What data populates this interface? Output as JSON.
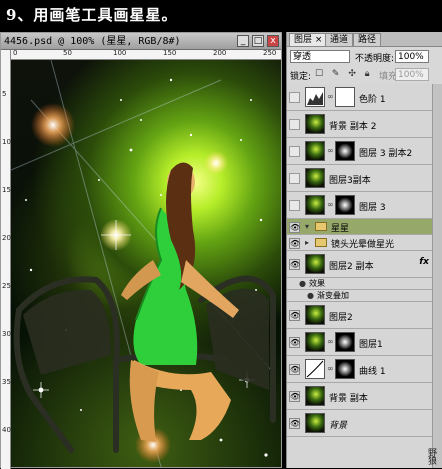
{
  "page": {
    "title": "9、用画笔工具画星星。"
  },
  "document": {
    "title": "4456.psd @ 100% (星星, RGB/8#)",
    "ruler_top_labels": [
      "0",
      "50",
      "100",
      "150",
      "200",
      "250"
    ],
    "ruler_left_labels": [
      "5",
      "10",
      "15",
      "20",
      "25",
      "30",
      "35",
      "40"
    ],
    "buttons": {
      "minimize": "_",
      "maximize": "□",
      "close": "x"
    }
  },
  "layers_panel": {
    "tabs": [
      "图层",
      "通道",
      "路径"
    ],
    "tab_close": "×",
    "blend_mode": "穿透",
    "opacity_label": "不透明度:",
    "opacity_value": "100%",
    "lock_label": "锁定:",
    "fill_label": "填充:",
    "fill_value": "100%",
    "layers": [
      {
        "name": "色阶 1",
        "visible": false,
        "type": "adjustment"
      },
      {
        "name": "背景 副本 2",
        "visible": false,
        "type": "pixel"
      },
      {
        "name": "图层 3 副本2",
        "visible": false,
        "type": "masked"
      },
      {
        "name": "图层3副本",
        "visible": false,
        "type": "pixel"
      },
      {
        "name": "图层 3",
        "visible": false,
        "type": "masked"
      },
      {
        "name": "星星",
        "visible": true,
        "type": "group",
        "selected": true
      },
      {
        "name": "镜头光晕做星光",
        "visible": true,
        "type": "group"
      },
      {
        "name": "图层2 副本",
        "visible": true,
        "type": "pixel",
        "fx": "fx"
      },
      {
        "name": "效果",
        "type": "effect-header"
      },
      {
        "name": "渐变叠加",
        "type": "effect"
      },
      {
        "name": "图层2",
        "visible": true,
        "type": "pixel"
      },
      {
        "name": "图层1",
        "visible": true,
        "type": "masked"
      },
      {
        "name": "曲线 1",
        "visible": true,
        "type": "curves"
      },
      {
        "name": "背景 副本",
        "visible": true,
        "type": "pixel"
      },
      {
        "name": "背景",
        "visible": true,
        "type": "pixel"
      }
    ]
  },
  "colors": {
    "selected_layer": "#97a86b",
    "panel_bg": "#d6d6d6",
    "glow": "#b7ee2a"
  }
}
